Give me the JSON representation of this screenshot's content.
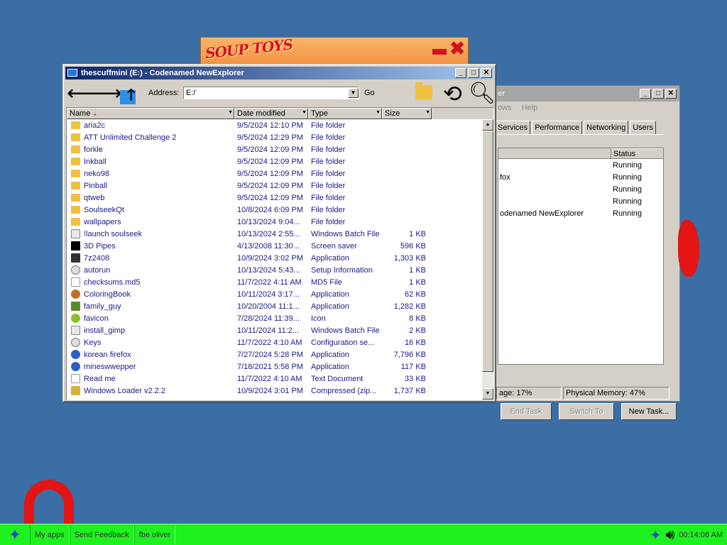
{
  "soup": {
    "logo": "SOUP TOYS"
  },
  "taskmgr": {
    "title": "er",
    "menu": [
      "ows",
      "Help"
    ],
    "tabs": [
      "Services",
      "Performance",
      "Networking",
      "Users"
    ],
    "columns": {
      "status": "Status"
    },
    "rows": [
      {
        "name": "",
        "status": "Running"
      },
      {
        "name": "fox",
        "status": "Running"
      },
      {
        "name": "",
        "status": "Running"
      },
      {
        "name": "",
        "status": "Running"
      },
      {
        "name": "odenamed NewExplorer",
        "status": "Running"
      }
    ],
    "buttons": {
      "end_task": "End Task",
      "switch_to": "Switch To",
      "new_task": "New Task..."
    },
    "status": {
      "cpu": "age: 17%",
      "memory": "Physical Memory: 47%"
    }
  },
  "explorer": {
    "title": "thescuffmini (E:) - Codenamed NewExplorer",
    "address_label": "Address:",
    "address_value": "E:/",
    "go_label": "Go",
    "columns": {
      "name": "Name",
      "date": "Date modified",
      "type": "Type",
      "size": "Size"
    },
    "files": [
      {
        "icon": "folder",
        "name": "aria2c",
        "date": "9/5/2024 12:10 PM",
        "type": "File folder",
        "size": ""
      },
      {
        "icon": "folder",
        "name": "ATT Unlimited Challenge 2",
        "date": "9/5/2024 12:29 PM",
        "type": "File folder",
        "size": ""
      },
      {
        "icon": "folder",
        "name": "forkle",
        "date": "9/5/2024 12:09 PM",
        "type": "File folder",
        "size": ""
      },
      {
        "icon": "folder",
        "name": "Inkball",
        "date": "9/5/2024 12:09 PM",
        "type": "File folder",
        "size": ""
      },
      {
        "icon": "folder",
        "name": "neko98",
        "date": "9/5/2024 12:09 PM",
        "type": "File folder",
        "size": ""
      },
      {
        "icon": "folder",
        "name": "Pinball",
        "date": "9/5/2024 12:09 PM",
        "type": "File folder",
        "size": ""
      },
      {
        "icon": "folder",
        "name": "qtweb",
        "date": "9/5/2024 12:09 PM",
        "type": "File folder",
        "size": ""
      },
      {
        "icon": "folder",
        "name": "SoulseekQt",
        "date": "10/8/2024 6:09 PM",
        "type": "File folder",
        "size": ""
      },
      {
        "icon": "folder",
        "name": "wallpapers",
        "date": "10/13/2024 9:04...",
        "type": "File folder",
        "size": ""
      },
      {
        "icon": "batch",
        "name": "!launch soulseek",
        "date": "10/13/2024 2:55...",
        "type": "Windows Batch File",
        "size": "1 KB"
      },
      {
        "icon": "scr",
        "name": "3D Pipes",
        "date": "4/13/2008 11:30...",
        "type": "Screen saver",
        "size": "596 KB"
      },
      {
        "icon": "app",
        "name": "7z2408",
        "date": "10/9/2024 3:02 PM",
        "type": "Application",
        "size": "1,303 KB"
      },
      {
        "icon": "setup",
        "name": "autorun",
        "date": "10/13/2024 5:43...",
        "type": "Setup Information",
        "size": "1 KB"
      },
      {
        "icon": "file",
        "name": "checksums.md5",
        "date": "11/7/2022 4:11 AM",
        "type": "MD5 File",
        "size": "1 KB"
      },
      {
        "icon": "paint",
        "name": "ColoringBook",
        "date": "10/11/2024 3:17...",
        "type": "Application",
        "size": "62 KB"
      },
      {
        "icon": "green",
        "name": "family_guy",
        "date": "10/20/2004 11:1...",
        "type": "Application",
        "size": "1,282 KB"
      },
      {
        "icon": "fav",
        "name": "favicon",
        "date": "7/28/2024 11:39...",
        "type": "Icon",
        "size": "8 KB"
      },
      {
        "icon": "batch",
        "name": "install_gimp",
        "date": "10/11/2024 11:2...",
        "type": "Windows Batch File",
        "size": "2 KB"
      },
      {
        "icon": "setup",
        "name": "Keys",
        "date": "11/7/2022 4:10 AM",
        "type": "Configuration se...",
        "size": "16 KB"
      },
      {
        "icon": "globe",
        "name": "korean firefox",
        "date": "7/27/2024 5:28 PM",
        "type": "Application",
        "size": "7,796 KB"
      },
      {
        "icon": "globe",
        "name": "mineswwepper",
        "date": "7/18/2021 5:58 PM",
        "type": "Application",
        "size": "117 KB"
      },
      {
        "icon": "file",
        "name": "Read me",
        "date": "11/7/2022 4:10 AM",
        "type": "Text Document",
        "size": "33 KB"
      },
      {
        "icon": "zip",
        "name": "Windows Loader v2.2.2",
        "date": "10/9/2024 3:01 PM",
        "type": "Compressed (zip...",
        "size": "1,737 KB"
      }
    ]
  },
  "taskbar": {
    "items": [
      "My apps",
      "Send Feedback",
      "fbe oliver"
    ],
    "clock": "00:14:08 AM"
  }
}
